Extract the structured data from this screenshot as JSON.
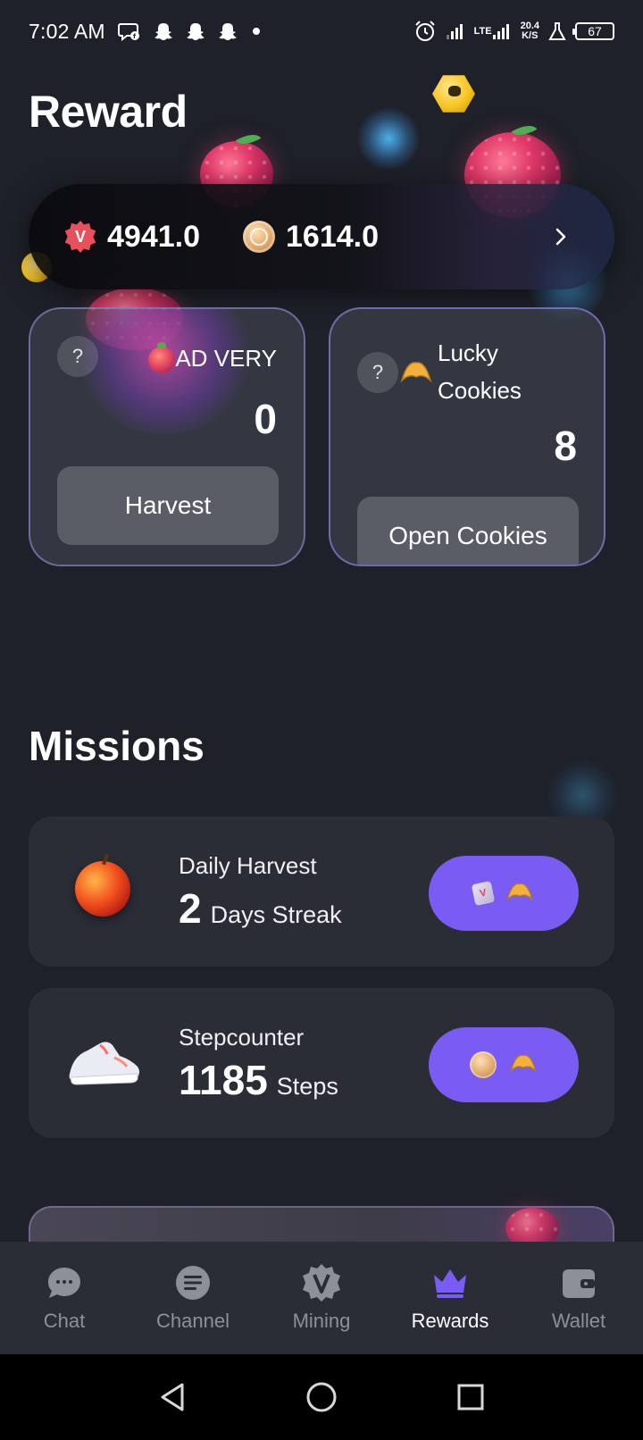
{
  "status_bar": {
    "time": "7:02 AM",
    "network": "LTE",
    "speed_value": "20.4",
    "speed_unit": "K/S",
    "battery": "67",
    "icons": [
      "messenger-icon",
      "snapchat-icon",
      "snapchat-icon",
      "snapchat-icon",
      "dot-icon",
      "alarm-icon",
      "signal-icon",
      "lte-signal-icon",
      "lab-icon",
      "battery-icon"
    ]
  },
  "header": {
    "title": "Reward"
  },
  "balances": {
    "v_points": "4941.0",
    "coins": "1614.0",
    "chevron_icon": "chevron-right-icon"
  },
  "ad_card": {
    "help": "?",
    "label": "AD VERY",
    "value": "0",
    "button": "Harvest"
  },
  "cookie_card": {
    "help": "?",
    "label_line1": "Lucky",
    "label_line2": "Cookies",
    "value": "8",
    "button": "Open Cookies"
  },
  "missions": {
    "title": "Missions",
    "items": [
      {
        "name": "Daily Harvest",
        "number": "2",
        "unit": "Days Streak",
        "art_icon": "fruit-icon",
        "reward_icons": [
          "ticket-icon",
          "fortune-cookie-icon"
        ]
      },
      {
        "name": "Stepcounter",
        "number": "1185",
        "unit": "Steps",
        "art_icon": "sneaker-icon",
        "reward_icons": [
          "coin-icon",
          "fortune-cookie-icon"
        ]
      }
    ]
  },
  "tabs": [
    {
      "label": "Chat",
      "icon": "chat-bubble-icon",
      "active": false
    },
    {
      "label": "Channel",
      "icon": "channel-icon",
      "active": false
    },
    {
      "label": "Mining",
      "icon": "v-badge-icon",
      "active": false
    },
    {
      "label": "Rewards",
      "icon": "crown-icon",
      "active": true
    },
    {
      "label": "Wallet",
      "icon": "wallet-icon",
      "active": false
    }
  ],
  "system_nav": [
    "back-icon",
    "home-icon",
    "recents-icon"
  ],
  "colors": {
    "background": "#1e2129",
    "card": "#2a2d36",
    "accent": "#7a5cf5",
    "button_gray": "#5b5d66"
  }
}
